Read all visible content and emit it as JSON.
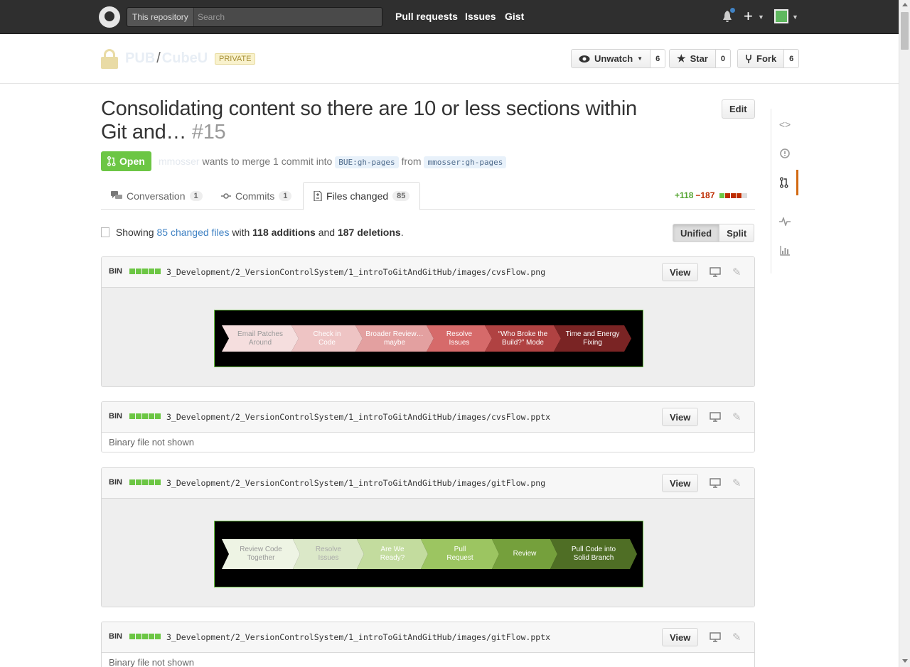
{
  "header": {
    "search_scope": "This repository",
    "search_placeholder": "Search",
    "nav": [
      "Pull requests",
      "Issues",
      "Gist"
    ],
    "plus": "+"
  },
  "repo": {
    "owner": "PUB",
    "name": "CubeU",
    "visibility": "PRIVATE",
    "watch_label": "Unwatch",
    "watch_count": "6",
    "star_label": "Star",
    "star_count": "0",
    "fork_label": "Fork",
    "fork_count": "6"
  },
  "pr": {
    "title": "Consolidating content so there are 10 or less sections within Git and…",
    "number": "#15",
    "edit_label": "Edit",
    "state": "Open",
    "author": "mmosser",
    "merge_text": "wants to merge 1 commit into",
    "base_ref": "BUE:gh-pages",
    "from_text": "from",
    "head_ref": "mmosser:gh-pages"
  },
  "tabs": [
    {
      "label": "Conversation",
      "count": "1"
    },
    {
      "label": "Commits",
      "count": "1"
    },
    {
      "label": "Files changed",
      "count": "85"
    }
  ],
  "diffstat": {
    "additions": "+118",
    "deletions": "−187"
  },
  "toc": {
    "showing": "Showing",
    "files_link": "85 changed files",
    "with": "with",
    "additions": "118 additions",
    "and": "and",
    "deletions": "187 deletions",
    "period": ".",
    "unified": "Unified",
    "split": "Split"
  },
  "files": [
    {
      "type": "BIN",
      "path": "3_Development/2_VersionControlSystem/1_introToGitAndGitHub/images/cvsFlow.png",
      "view": "View"
    },
    {
      "type": "BIN",
      "path": "3_Development/2_VersionControlSystem/1_introToGitAndGitHub/images/cvsFlow.pptx",
      "view": "View",
      "note": "Binary file not shown"
    },
    {
      "type": "BIN",
      "path": "3_Development/2_VersionControlSystem/1_introToGitAndGitHub/images/gitFlow.png",
      "view": "View"
    },
    {
      "type": "BIN",
      "path": "3_Development/2_VersionControlSystem/1_introToGitAndGitHub/images/gitFlow.pptx",
      "view": "View",
      "note": "Binary file not shown"
    }
  ],
  "cvs_flow": [
    {
      "label": "Email Patches\nAround",
      "bg": "#f5dede",
      "fg": "#999999"
    },
    {
      "label": "Check in\nCode",
      "bg": "#eec4c4",
      "fg": "#ffffff"
    },
    {
      "label": "Broader Review…\nmaybe",
      "bg": "#e3a0a0",
      "fg": "#ffffff"
    },
    {
      "label": "Resolve\nIssues",
      "bg": "#d66a6a",
      "fg": "#ffffff"
    },
    {
      "label": "“Who Broke the\nBuild?” Mode",
      "bg": "#b04242",
      "fg": "#ffffff"
    },
    {
      "label": "Time and Energy\nFixing",
      "bg": "#7a2424",
      "fg": "#ffffff"
    }
  ],
  "git_flow": [
    {
      "label": "Review Code\nTogether",
      "bg": "#eef4e4",
      "fg": "#999999"
    },
    {
      "label": "Resolve\nIssues",
      "bg": "#dbe8c8",
      "fg": "#aaaaaa"
    },
    {
      "label": "Are We\nReady?",
      "bg": "#c3dc9e",
      "fg": "#ffffff"
    },
    {
      "label": "Pull\nRequest",
      "bg": "#9cc561",
      "fg": "#ffffff"
    },
    {
      "label": "Review",
      "bg": "#75a03c",
      "fg": "#ffffff"
    },
    {
      "label": "Pull Code into\nSolid Branch",
      "bg": "#4f6e25",
      "fg": "#ffffff"
    }
  ],
  "colors": {
    "open_green": "#6cc644",
    "link_blue": "#4183c4",
    "addition_green": "#55a532",
    "deletion_red": "#bd2c00",
    "active_tab_orange": "#d26911"
  }
}
